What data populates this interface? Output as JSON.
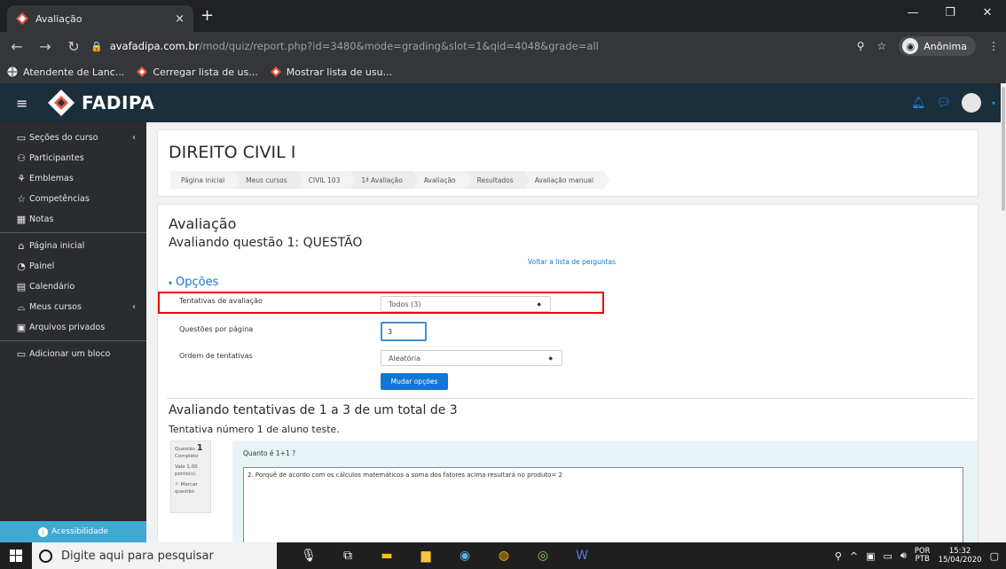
{
  "browser": {
    "tab_title": "Avaliação",
    "tab_close": "×",
    "new_tab": "+",
    "url_host": "avafadipa.com.br",
    "url_path": "/mod/quiz/report.php?id=3480&mode=grading&slot=1&qid=4048&grade=all",
    "profile_label": "Anônima",
    "bookmarks": [
      "Atendente de Lanc...",
      "Cerregar lista de us...",
      "Mostrar lista de usu..."
    ]
  },
  "header": {
    "logo_text": "FADIPA"
  },
  "sidebar": {
    "items": [
      {
        "label": "Seções do curso",
        "icon": "folder-icon"
      },
      {
        "label": "Participantes",
        "icon": "users-icon"
      },
      {
        "label": "Emblemas",
        "icon": "badge-icon"
      },
      {
        "label": "Competências",
        "icon": "star-icon"
      },
      {
        "label": "Notas",
        "icon": "grades-icon"
      },
      {
        "label": "Página inicial",
        "icon": "home-icon"
      },
      {
        "label": "Painel",
        "icon": "dashboard-icon"
      },
      {
        "label": "Calendário",
        "icon": "calendar-icon"
      },
      {
        "label": "Meus cursos",
        "icon": "graduation-cap-icon"
      },
      {
        "label": "Arquivos privados",
        "icon": "files-icon"
      },
      {
        "label": "Adicionar um bloco",
        "icon": "add-block-icon"
      }
    ],
    "accessibility_label": "Acessibilidade"
  },
  "course": {
    "title": "DIREITO CIVIL I",
    "breadcrumb": [
      "Página inicial",
      "Meus cursos",
      "CIVIL 103",
      "1ª Avaliação",
      "Avaliação",
      "Resultados",
      "Avaliação manual"
    ]
  },
  "grading": {
    "heading": "Avaliação",
    "subheading": "Avaliando questão 1: QUESTÃO",
    "back_link": "Voltar a lista de perguntas",
    "options_heading": "Opções",
    "field_attempts_label": "Tentativas de avaliação",
    "field_attempts_value": "Todos (3)",
    "field_per_page_label": "Questões por página",
    "field_per_page_value": "3",
    "field_order_label": "Ordem de tentativas",
    "field_order_value": "Aleatória",
    "change_button": "Mudar opções",
    "attempts_heading": "Avaliando tentativas de 1 a 3 de um total de 3",
    "attempt_number": "Tentativa número 1 de aluno teste.",
    "question_info": {
      "label": "Questão",
      "number": "1",
      "status": "Completo",
      "worth": "Vale 1,00 ponto(s).",
      "flag": "Marcar questão"
    },
    "question_text": "Quanto é 1+1 ?",
    "answer_text": "2. Porquê de acordo com os cálculos matemáticos a soma dos fatores acima resultará no produto= 2"
  },
  "taskbar": {
    "search_placeholder": "Digite aqui para pesquisar",
    "lang_top": "POR",
    "lang_bottom": "PTB",
    "time": "15:32",
    "date": "15/04/2020"
  }
}
